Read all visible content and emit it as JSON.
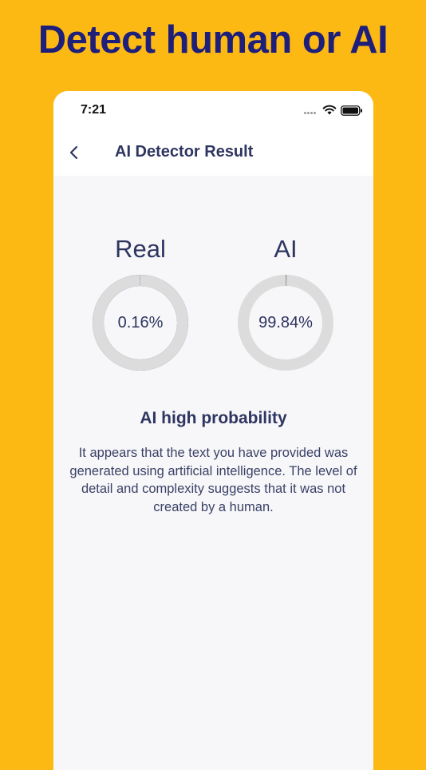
{
  "headline": "Detect human or AI",
  "status_bar": {
    "time": "7:21",
    "icons": [
      "signal-dots-icon",
      "wifi-icon",
      "battery-icon"
    ]
  },
  "nav": {
    "back_icon": "chevron-left-icon",
    "title": "AI Detector Result"
  },
  "gauges": [
    {
      "label": "Real",
      "value_text": "0.16%",
      "percent": 0.16,
      "color": "#2B3068"
    },
    {
      "label": "AI",
      "value_text": "99.84%",
      "percent": 99.84,
      "color": "#DCDCDC"
    }
  ],
  "result": {
    "title": "AI high probability",
    "description": "It appears that the text you have provided was generated using artificial intelligence. The level of detail and complexity suggests that it was not created by a human."
  },
  "colors": {
    "background": "#FDB913",
    "headline": "#1E1F7A",
    "navy": "#2B3068",
    "ring_gray": "#DCDCDC",
    "screen_bg": "#F7F7F9"
  }
}
